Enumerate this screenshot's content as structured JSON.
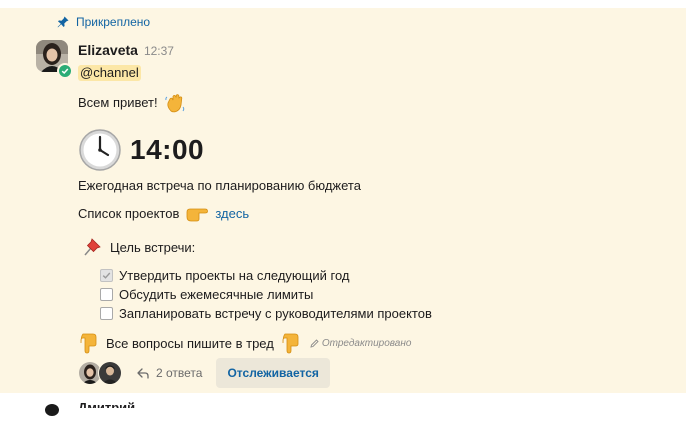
{
  "pinned": {
    "label": "Прикреплено"
  },
  "message": {
    "author": "Elizaveta",
    "time": "12:37",
    "mention": "@channel",
    "greeting": "Всем привет!",
    "big_time": "14:00",
    "meeting_title": "Ежегодная встреча по планированию бюджета",
    "projects_text": "Список проектов",
    "projects_link": "здесь",
    "goal_label": "Цель встречи:",
    "checklist": [
      {
        "label": "Утвердить проекты на следующий год",
        "checked": true
      },
      {
        "label": "Обсудить ежемесячные лимиты",
        "checked": false
      },
      {
        "label": "Запланировать встречу с руководителями проектов",
        "checked": false
      }
    ],
    "questions": "Все вопросы пишите в тред",
    "edited": "Отредактировано"
  },
  "thread": {
    "reply_count": "2 ответа",
    "follow_label": "Отслеживается"
  },
  "next_message": {
    "author": "Дмитрий"
  },
  "colors": {
    "highlight_bg": "#fdf6e3",
    "link": "#1264a3",
    "mention_bg": "#fce7a7",
    "presence": "#2bac76"
  },
  "icons": [
    "pin-icon",
    "wave-emoji-icon",
    "clock-emoji-icon",
    "pointing-right-emoji-icon",
    "pushpin-emoji-icon",
    "pointing-down-emoji-icon",
    "pencil-icon",
    "reply-icon",
    "checkmark-icon"
  ]
}
